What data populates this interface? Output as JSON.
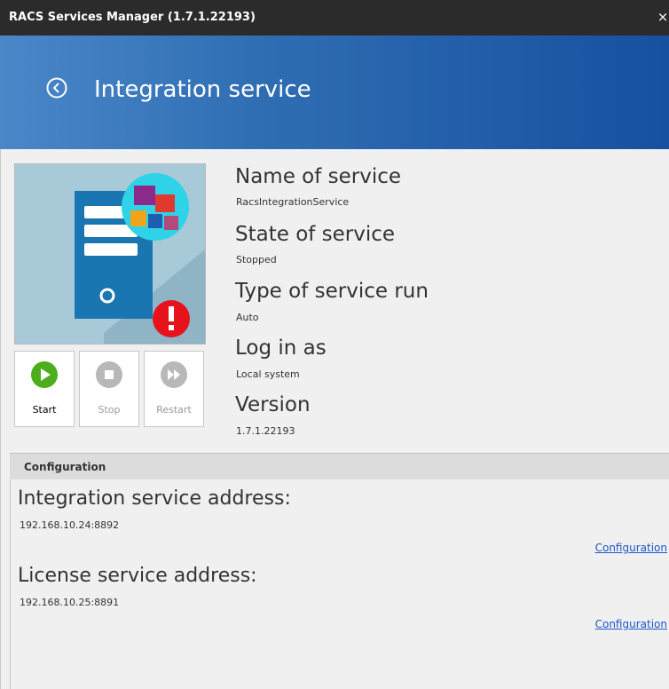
{
  "window": {
    "title": "RACS Services Manager (1.7.1.22193)",
    "close": "×"
  },
  "header": {
    "title": "Integration service",
    "back_icon": "back-arrow-icon"
  },
  "actions": [
    {
      "label": "Start",
      "icon": "play-icon",
      "enabled": true,
      "color": "#4cae1a"
    },
    {
      "label": "Stop",
      "icon": "stop-icon",
      "enabled": false,
      "color": "#b8b8b8"
    },
    {
      "label": "Restart",
      "icon": "fast-forward-icon",
      "enabled": false,
      "color": "#b8b8b8"
    }
  ],
  "info": {
    "name_label": "Name of service",
    "name_value": "RacsIntegrationService",
    "state_label": "State of service",
    "state_value": "Stopped",
    "type_label": "Type of service run",
    "type_value": "Auto",
    "login_label": "Log in as",
    "login_value": "Local system",
    "version_label": "Version",
    "version_value": "1.7.1.22193"
  },
  "configuration": {
    "header": "Configuration",
    "items": [
      {
        "label": "Integration service address:",
        "value": "192.168.10.24:8892",
        "link": "Configuration"
      },
      {
        "label": "License service address:",
        "value": "192.168.10.25:8891",
        "link": "Configuration"
      }
    ]
  },
  "colors": {
    "header_gradient_start": "#4a87c9",
    "header_gradient_end": "#1650a0",
    "link": "#1b56c9",
    "warning": "#e8121c"
  }
}
